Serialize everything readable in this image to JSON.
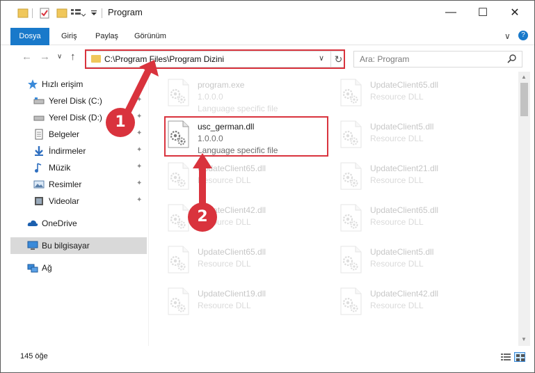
{
  "window": {
    "title": "Program",
    "minimize": "—",
    "maximize": "☐",
    "close": "✕"
  },
  "ribbon": {
    "tabs": [
      "Dosya",
      "Giriş",
      "Paylaş",
      "Görünüm"
    ],
    "collapse_glyph": "∨",
    "help_glyph": "?"
  },
  "address_bar": {
    "path": "C:\\Program Files\\Program Dizini",
    "dropdown_glyph": "∨",
    "refresh_glyph": "↻"
  },
  "search": {
    "placeholder": "Ara: Program",
    "icon": "search-icon"
  },
  "navigation": {
    "back_glyph": "←",
    "forward_glyph": "→",
    "recent_glyph": "∨",
    "up_glyph": "↑"
  },
  "nav_pane": {
    "items": [
      {
        "label": "Hızlı erişim",
        "icon": "star-icon",
        "pinned": false
      },
      {
        "label": "Yerel Disk (C:)",
        "icon": "drive-icon",
        "pinned": true
      },
      {
        "label": "Yerel Disk (D:)",
        "icon": "drive-icon",
        "pinned": true
      },
      {
        "label": "Belgeler",
        "icon": "documents-icon",
        "pinned": true
      },
      {
        "label": "İndirmeler",
        "icon": "download-icon",
        "pinned": true
      },
      {
        "label": "Müzik",
        "icon": "music-icon",
        "pinned": true
      },
      {
        "label": "Resimler",
        "icon": "pictures-icon",
        "pinned": true
      },
      {
        "label": "Videolar",
        "icon": "videos-icon",
        "pinned": true
      },
      {
        "label": "OneDrive",
        "icon": "cloud-icon",
        "pinned": false
      },
      {
        "label": "Bu bilgisayar",
        "icon": "computer-icon",
        "pinned": false
      },
      {
        "label": "Ağ",
        "icon": "network-icon",
        "pinned": false
      }
    ],
    "pin_glyph": "📌"
  },
  "files": {
    "items": [
      {
        "name": "program.exe",
        "desc": "1.0.0.0",
        "sub": "Language specific file",
        "faded": true
      },
      {
        "name": "UpdateClient65.dll",
        "desc": "Resource DLL",
        "faded": true
      },
      {
        "name": "usc_german.dll",
        "desc": "1.0.0.0",
        "sub": "Language specific file",
        "faded": false
      },
      {
        "name": "UpdateClient5.dll",
        "desc": "Resource DLL",
        "faded": true
      },
      {
        "name": "UpdateClient65.dll",
        "desc": "Resource DLL",
        "faded": true
      },
      {
        "name": "UpdateClient21.dll",
        "desc": "Resource DLL",
        "faded": true
      },
      {
        "name": "UpdateClient42.dll",
        "desc": "Resource DLL",
        "faded": true
      },
      {
        "name": "UpdateClient65.dll",
        "desc": "Resource DLL",
        "faded": true
      },
      {
        "name": "UpdateClient65.dll",
        "desc": "Resource DLL",
        "faded": true
      },
      {
        "name": "UpdateClient5.dll",
        "desc": "Resource DLL",
        "faded": true
      },
      {
        "name": "UpdateClient19.dll",
        "desc": "Resource DLL",
        "faded": true
      },
      {
        "name": "UpdateClient42.dll",
        "desc": "Resource DLL",
        "faded": true
      }
    ]
  },
  "status_bar": {
    "count": "145 öğe"
  },
  "annotations": {
    "step1": "1",
    "step2": "2",
    "color": "#d9333d"
  }
}
